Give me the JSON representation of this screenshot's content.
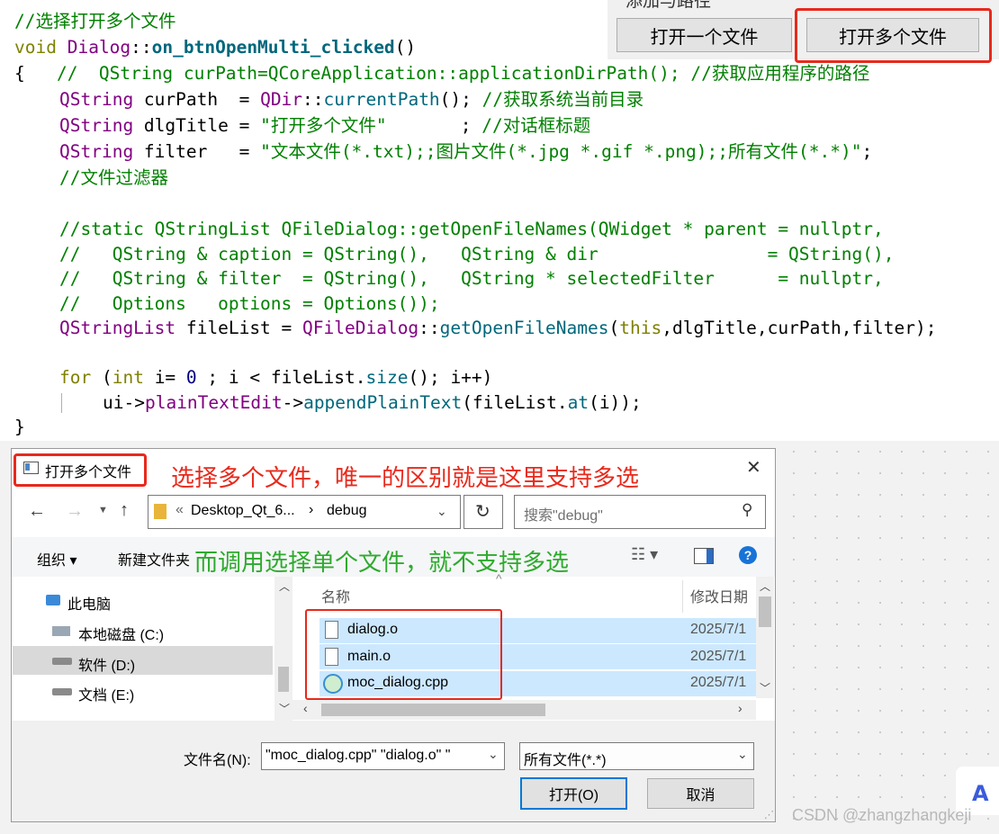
{
  "code": {
    "lines": [
      "//选择打开多个文件",
      "void Dialog::on_btnOpenMulti_clicked()",
      "{   //  QString curPath=QCoreApplication::applicationDirPath(); //获取应用程序的路径",
      "QString curPath  = QDir::currentPath(); //获取系统当前目录",
      "QString dlgTitle = \"打开多个文件\"       ; //对话框标题",
      "QString filter   = \"文本文件(*.txt);;图片文件(*.jpg *.gif *.png);;所有文件(*.*)\";",
      "//文件过滤器",
      "//static QStringList QFileDialog::getOpenFileNames(QWidget * parent = nullptr,",
      "//   QString & caption = QString(),   QString & dir                = QString(),",
      "//   QString & filter  = QString(),   QString * selectedFilter      = nullptr,",
      "//   Options   options = Options());",
      "QStringList fileList = QFileDialog::getOpenFileNames(this,dlgTitle,curPath,filter);",
      "for (int i= 0 ; i < fileList.size(); i++)",
      "ui->plainTextEdit->appendPlainText(fileList.at(i));",
      "}"
    ]
  },
  "top_buttons": {
    "cut_label": "添加与路径",
    "open_one": "打开一个文件",
    "open_multi": "打开多个文件"
  },
  "dialog": {
    "title": "打开多个文件",
    "close": "✕",
    "path_prefix": "«",
    "path_part1": "Desktop_Qt_6...",
    "path_sep": "›",
    "path_part2": "debug",
    "search_placeholder": "搜索\"debug\"",
    "organize": "组织 ▾",
    "new_folder": "新建文件夹",
    "tree": [
      "此电脑",
      "本地磁盘 (C:)",
      "软件 (D:)",
      "文档 (E:)"
    ],
    "col_name": "名称",
    "col_date": "修改日期",
    "files": [
      {
        "name": "dialog.o",
        "date": "2025/7/1"
      },
      {
        "name": "main.o",
        "date": "2025/7/1"
      },
      {
        "name": "moc_dialog.cpp",
        "date": "2025/7/1"
      }
    ],
    "filename_label": "文件名(N):",
    "filename_value": "\"moc_dialog.cpp\" \"dialog.o\" \"",
    "filter_value": "所有文件(*.*)",
    "open_btn": "打开(O)",
    "cancel_btn": "取消"
  },
  "annotations": {
    "red": "选择多个文件，唯一的区别就是这里支持多选",
    "green": "而调用选择单个文件，就不支持多选"
  },
  "watermark": "CSDN @zhangzhangkeji",
  "colors": {
    "red": "#e8291c",
    "green": "#2eaa2e",
    "selection": "#cce8ff",
    "accent": "#0078d7"
  }
}
